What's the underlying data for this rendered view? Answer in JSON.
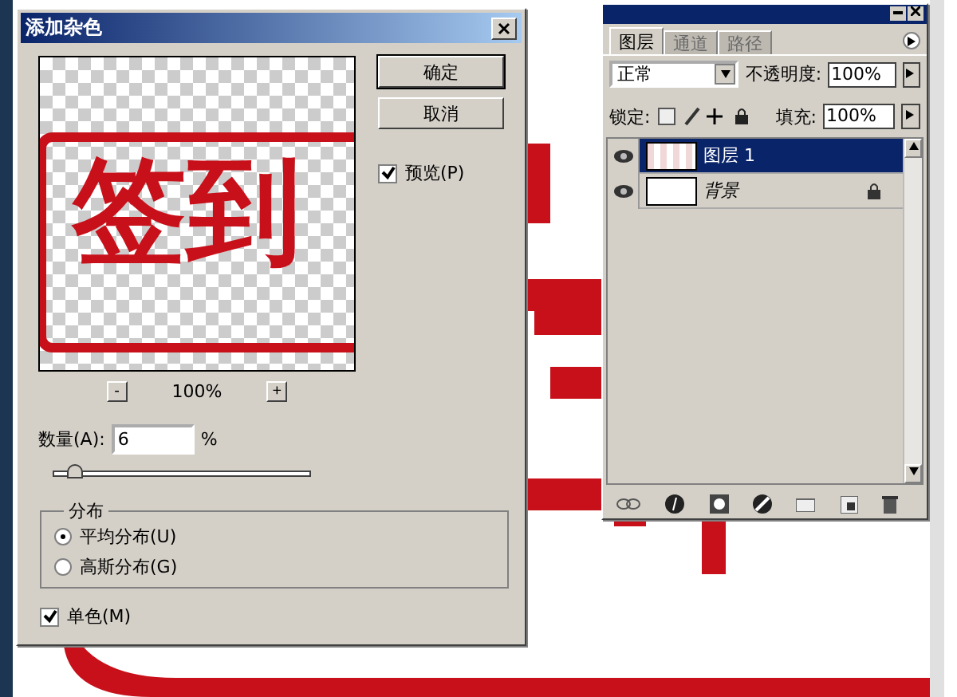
{
  "dialog": {
    "title": "添加杂色",
    "preview": {
      "text": "签到",
      "zoom": "100%",
      "zoom_out": "-",
      "zoom_in": "+"
    },
    "buttons": [
      "确定",
      "取消"
    ],
    "preview_check": {
      "label": "预览(P)",
      "checked": true
    },
    "amount": {
      "label": "数量(A):",
      "value": "6",
      "unit": "%",
      "level": 0.05
    },
    "distribution": {
      "title": "分布",
      "options": [
        {
          "label": "平均分布(U)",
          "selected": true
        },
        {
          "label": "高斯分布(G)",
          "selected": false
        }
      ]
    },
    "monochrome": {
      "label": "单色(M)",
      "checked": true
    }
  },
  "layers_panel": {
    "tabs": [
      {
        "label": "图层",
        "selected": true
      },
      {
        "label": "通道",
        "selected": false
      },
      {
        "label": "路径",
        "selected": false
      }
    ],
    "blend_mode": "正常",
    "opacity_label": "不透明度:",
    "opacity": "100%",
    "lock_label": "锁定:",
    "fill_label": "填充:",
    "fill": "100%",
    "layers": [
      {
        "name": "图层 1",
        "kind": "layer",
        "selected": true,
        "visible": true,
        "locked": false
      },
      {
        "name": "背景",
        "kind": "background",
        "selected": false,
        "visible": true,
        "locked": true
      }
    ]
  }
}
